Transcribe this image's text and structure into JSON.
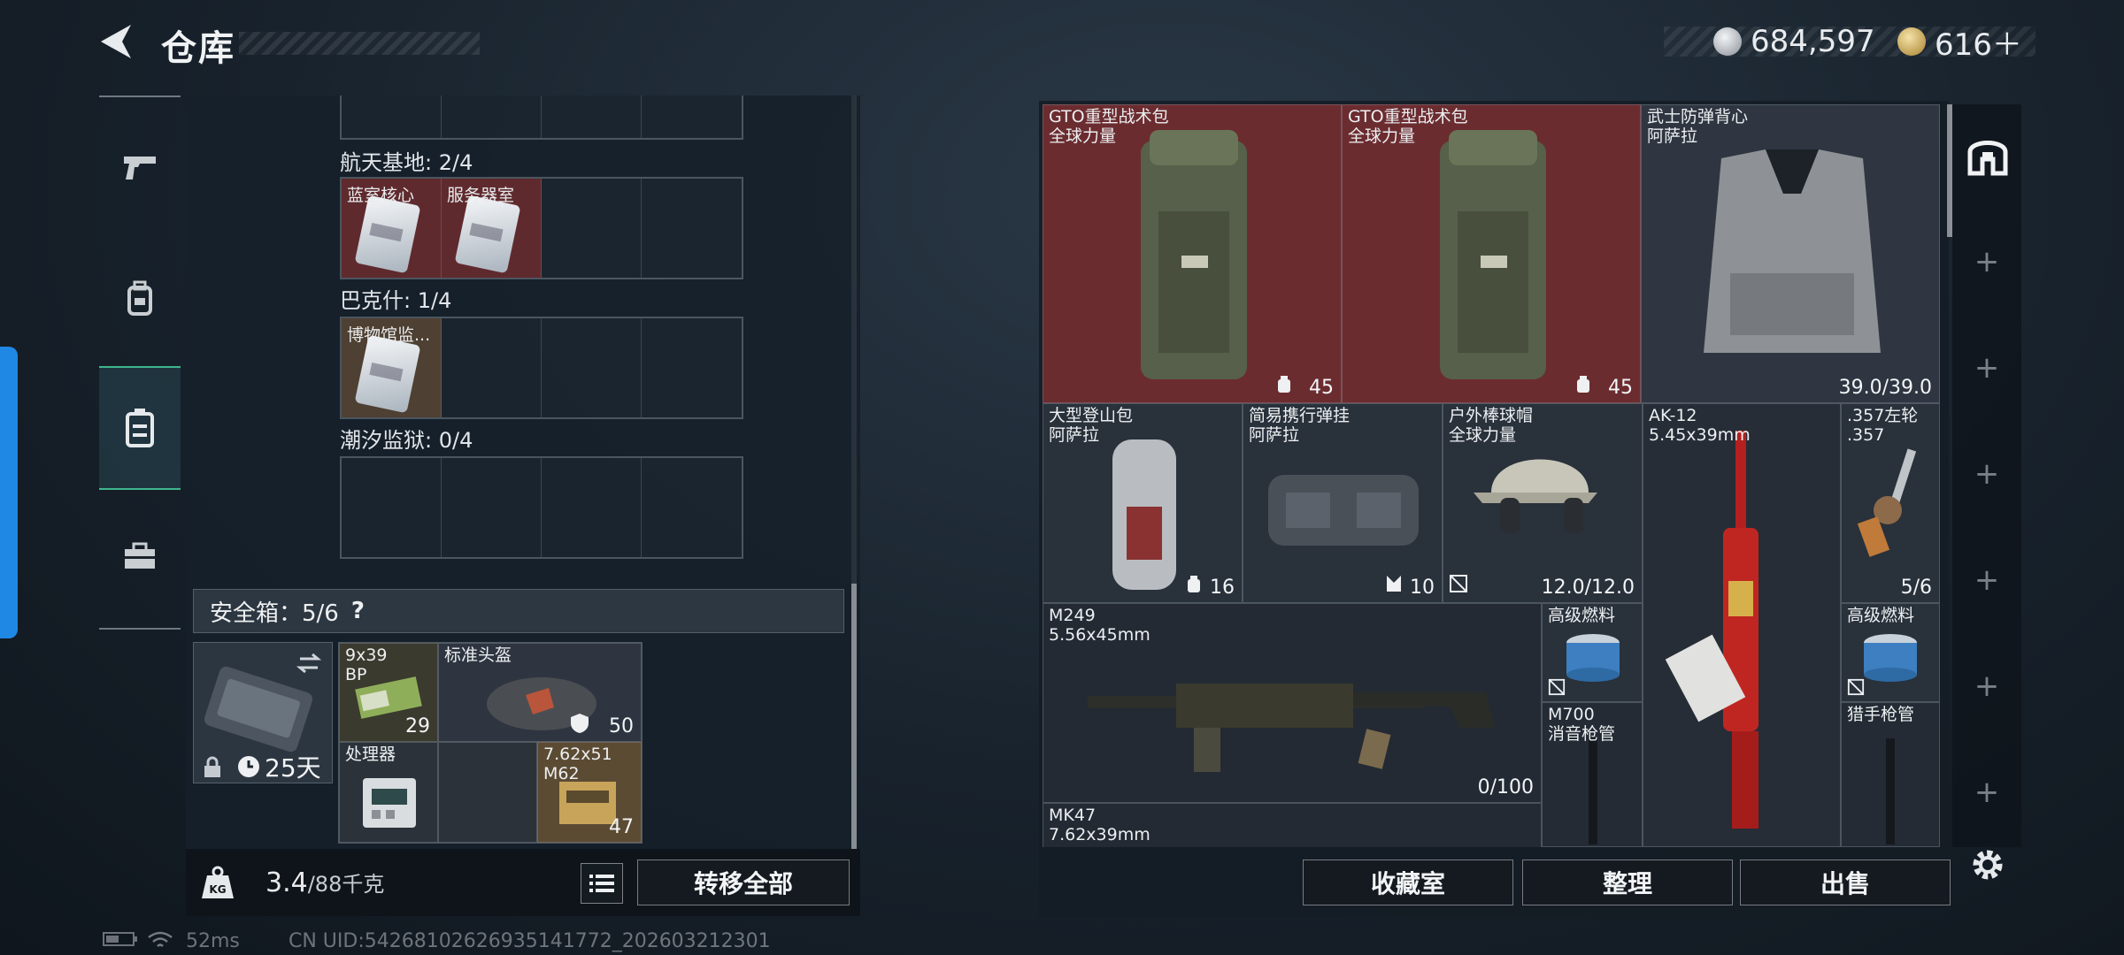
{
  "header": {
    "title": "仓库"
  },
  "currency": [
    {
      "icon": "silver-coin-icon",
      "value": "684,597"
    },
    {
      "icon": "gold-coin-icon",
      "value": "616＋"
    }
  ],
  "sidebar": {
    "items": [
      {
        "icon": "pistol-icon"
      },
      {
        "icon": "backpack-icon"
      },
      {
        "icon": "storage-case-icon",
        "active": true
      },
      {
        "icon": "toolbox-icon"
      }
    ]
  },
  "collection": {
    "sections": [
      {
        "label": "航天基地: 2/4",
        "cells": [
          "蓝室核心",
          "服务器室",
          "",
          ""
        ]
      },
      {
        "label": "巴克什: 1/4",
        "cells": [
          "博物馆监...",
          "",
          "",
          ""
        ]
      },
      {
        "label": "潮汐监狱: 0/4",
        "cells": [
          "",
          "",
          "",
          ""
        ]
      }
    ]
  },
  "safe_box": {
    "label": "安全箱：5/6",
    "help": "?",
    "days": "25天",
    "items": [
      {
        "name": "9x39\nBP",
        "count": "29"
      },
      {
        "name": "标准头盔",
        "count": "50"
      },
      {
        "name": "处理器",
        "count": ""
      },
      {
        "name": "7.62x51\nM62",
        "count": "47"
      }
    ]
  },
  "bottom": {
    "weight": "3.4",
    "weight_max": "/88千克",
    "transfer_all": "转移全部"
  },
  "stash": {
    "items": [
      {
        "name": "GTO重型战术包\n全球力量",
        "value": "45"
      },
      {
        "name": "GTO重型战术包\n全球力量",
        "value": "45"
      },
      {
        "name": "武士防弹背心\n阿萨拉",
        "value": "39.0/39.0"
      },
      {
        "name": "大型登山包\n阿萨拉",
        "value": "16"
      },
      {
        "name": "简易携行弹挂\n阿萨拉",
        "value": "10"
      },
      {
        "name": "户外棒球帽\n全球力量",
        "value": "12.0/12.0"
      },
      {
        "name": "AK-12\n5.45x39mm",
        "value": ""
      },
      {
        "name": ".357左轮\n.357",
        "value": "5/6"
      },
      {
        "name": "M249\n5.56x45mm",
        "value": "0/100"
      },
      {
        "name": "高级燃料",
        "value": ""
      },
      {
        "name": "高级燃料",
        "value": ""
      },
      {
        "name": "M700\n消音枪管",
        "value": ""
      },
      {
        "name": "猎手枪管",
        "value": ""
      },
      {
        "name": "MK47\n7.62x39mm",
        "value": ""
      }
    ]
  },
  "actions": {
    "collection": "收藏室",
    "sort": "整理",
    "sell": "出售"
  },
  "status_bar": {
    "ping": "52ms",
    "uid": "CN UID:5426810262693514177​2_202603212301"
  },
  "colors": {
    "red_slot": "#7a2d30",
    "active": "#3fb58c",
    "accent_tab": "#1f88e5"
  }
}
